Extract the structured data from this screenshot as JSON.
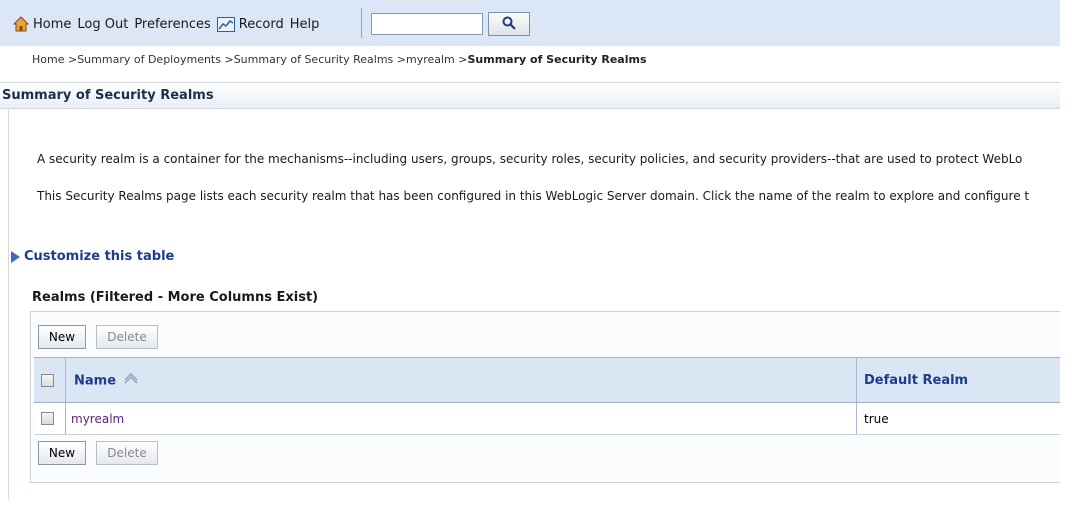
{
  "toolbar": {
    "home": "Home",
    "logout": "Log Out",
    "preferences": "Preferences",
    "record": "Record",
    "help": "Help",
    "search_value": ""
  },
  "breadcrumb": {
    "items": [
      "Home >",
      "Summary of Deployments >",
      "Summary of Security Realms >",
      "myrealm >"
    ],
    "current": "Summary of Security Realms"
  },
  "page": {
    "title": "Summary of Security Realms",
    "para1": "A security realm is a container for the mechanisms--including users, groups, security roles, security policies, and security providers--that are used to protect WebLo",
    "para2": "This Security Realms page lists each security realm that has been configured in this WebLogic Server domain. Click the name of the realm to explore and configure t",
    "customize": "Customize this table"
  },
  "realms": {
    "title": "Realms (Filtered - More Columns Exist)",
    "new_label": "New",
    "delete_label": "Delete",
    "columns": [
      "Name",
      "Default Realm"
    ],
    "rows": [
      {
        "name": "myrealm",
        "default_realm": "true"
      }
    ]
  },
  "colors": {
    "toolbar_bg": "#dbe7f7",
    "link_blue": "#1f3c8a",
    "visited_link": "#5a1e7a"
  }
}
